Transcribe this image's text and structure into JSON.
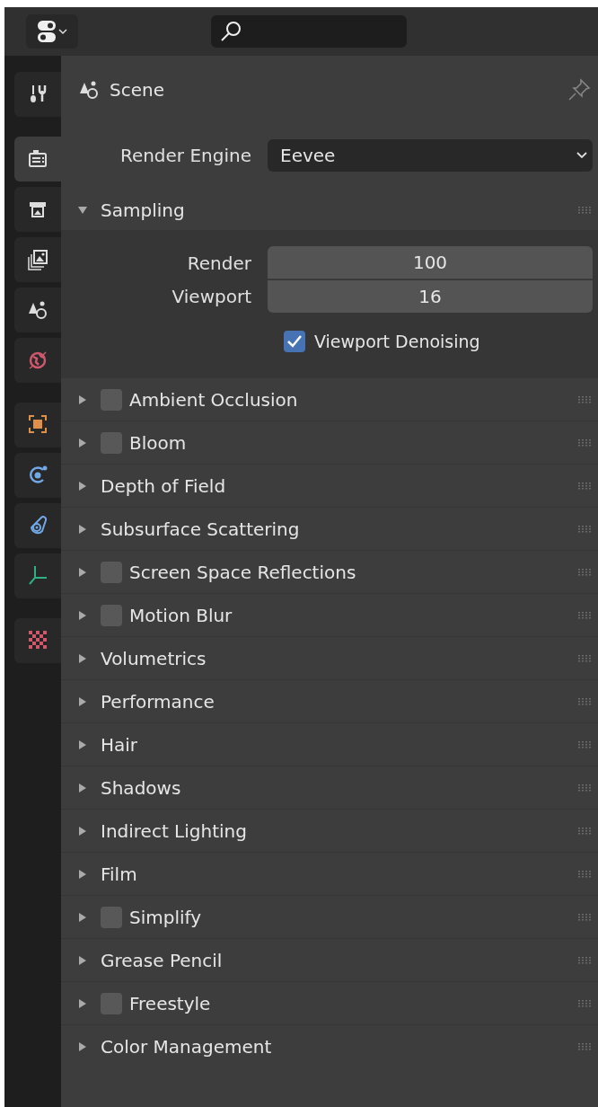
{
  "tab_groups": [
    [
      {
        "kind": "tool",
        "selected": false
      }
    ],
    [
      {
        "kind": "render",
        "selected": true
      },
      {
        "kind": "output",
        "selected": false
      },
      {
        "kind": "view_layer",
        "selected": false
      },
      {
        "kind": "scene",
        "selected": false
      },
      {
        "kind": "world",
        "selected": false
      }
    ],
    [
      {
        "kind": "object",
        "selected": false
      },
      {
        "kind": "physics",
        "selected": false
      },
      {
        "kind": "constraints",
        "selected": false
      },
      {
        "kind": "data",
        "selected": false
      }
    ],
    [
      {
        "kind": "texture",
        "selected": false
      }
    ]
  ],
  "context": {
    "title": "Scene"
  },
  "render_engine": {
    "label": "Render Engine",
    "value": "Eevee"
  },
  "panels": [
    {
      "title": "Sampling",
      "expanded": true,
      "fields": [
        {
          "label": "Render",
          "value": "100"
        },
        {
          "label": "Viewport",
          "value": "16"
        }
      ],
      "checkbox": {
        "label": "Viewport Denoising",
        "checked": true
      }
    },
    {
      "title": "Ambient Occlusion",
      "expanded": false,
      "checked": false
    },
    {
      "title": "Bloom",
      "expanded": false,
      "checked": false
    },
    {
      "title": "Depth of Field",
      "expanded": false
    },
    {
      "title": "Subsurface Scattering",
      "expanded": false
    },
    {
      "title": "Screen Space Reflections",
      "expanded": false,
      "checked": false
    },
    {
      "title": "Motion Blur",
      "expanded": false,
      "checked": false
    },
    {
      "title": "Volumetrics",
      "expanded": false
    },
    {
      "title": "Performance",
      "expanded": false
    },
    {
      "title": "Hair",
      "expanded": false
    },
    {
      "title": "Shadows",
      "expanded": false
    },
    {
      "title": "Indirect Lighting",
      "expanded": false
    },
    {
      "title": "Film",
      "expanded": false
    },
    {
      "title": "Simplify",
      "expanded": false,
      "checked": false
    },
    {
      "title": "Grease Pencil",
      "expanded": false
    },
    {
      "title": "Freestyle",
      "expanded": false,
      "checked": false
    },
    {
      "title": "Color Management",
      "expanded": false
    }
  ]
}
